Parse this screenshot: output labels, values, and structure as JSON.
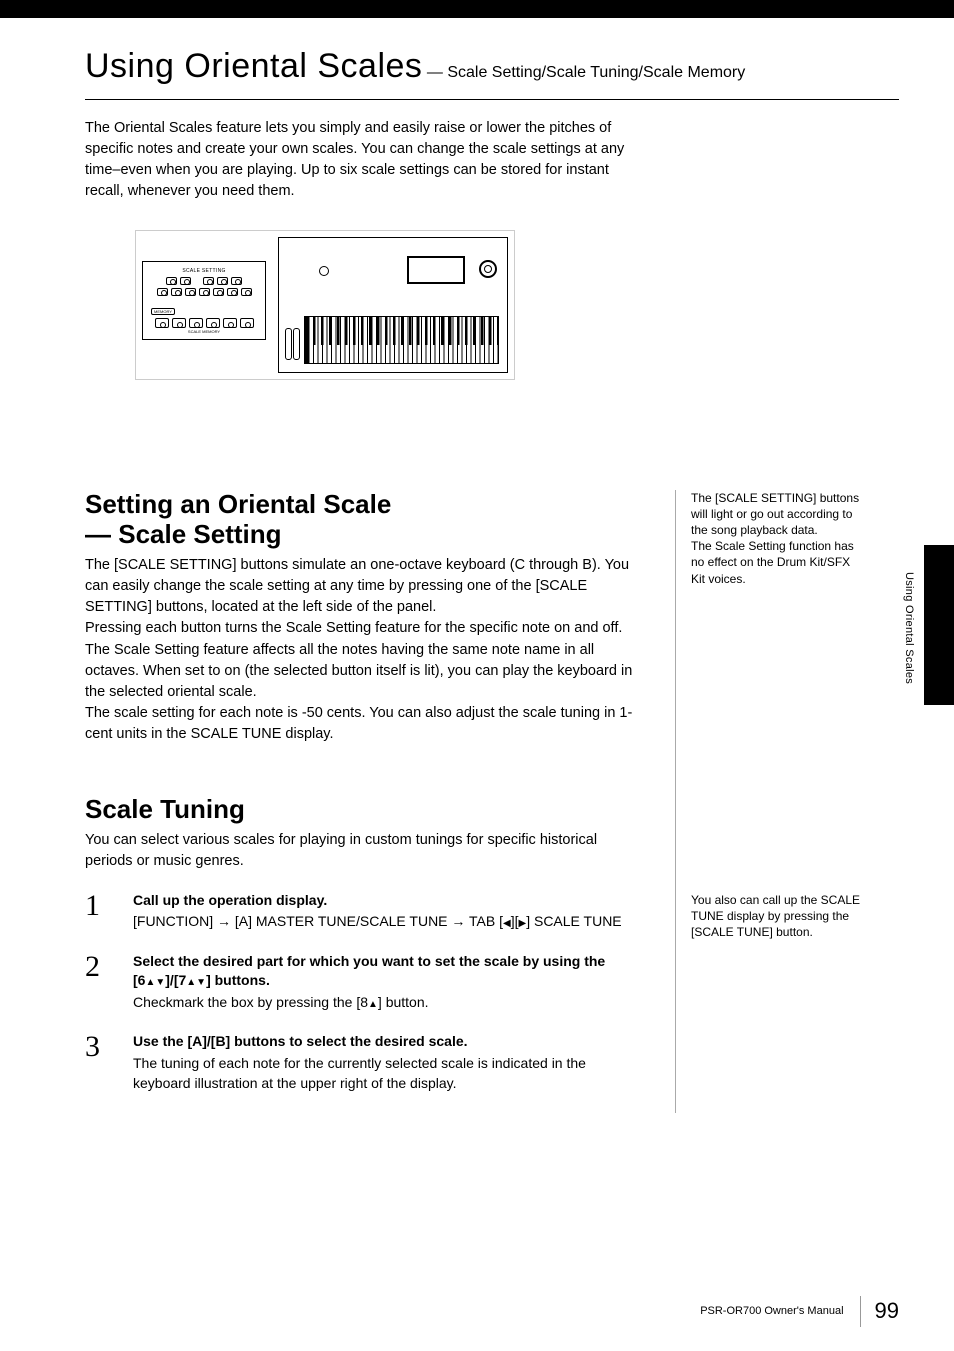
{
  "chapter": {
    "title_main": "Using Oriental Scales",
    "title_sep": " — ",
    "title_sub": "Scale Setting/Scale Tuning/Scale Memory"
  },
  "intro_text": "The Oriental Scales feature lets you simply and easily raise or lower the pitches of specific notes and create your own scales. You can change the scale settings at any time–even when you are playing. Up to six scale settings can be stored for instant recall, whenever you need them.",
  "figure": {
    "scale_setting_label": "SCALE SETTING",
    "memory_label": "MEMORY",
    "scale_memory_label": "SCALE MEMORY"
  },
  "section1": {
    "heading_line1": "Setting an Oriental Scale",
    "heading_line2": "— Scale Setting",
    "p1": "The [SCALE SETTING] buttons simulate an one-octave keyboard (C through B). You can easily change the scale setting at any time by pressing one of the [SCALE SETTING] buttons, located at the left side of the panel.",
    "p2": "Pressing each button turns the Scale Setting feature for the specific note on and off. The Scale Setting feature affects all the notes having the same note name in all octaves. When set to on (the selected button itself is lit), you can play the keyboard in the selected oriental scale.",
    "p3": "The scale setting for each note is -50 cents. You can also adjust the scale tuning in 1-cent units in the SCALE TUNE display."
  },
  "side1": "The [SCALE SETTING] buttons will light or go out according to the song playback data.\nThe Scale Setting function has no effect on the Drum Kit/SFX Kit voices.",
  "section2": {
    "heading": "Scale Tuning",
    "intro": "You can select various scales for playing in custom tunings for specific historical periods or music genres.",
    "steps": [
      {
        "num": "1",
        "title": "Call up the operation display.",
        "text_prefix": "[FUNCTION] → [A] MASTER TUNE/SCALE TUNE → TAB [",
        "text_mid": "][",
        "text_suffix": "] SCALE TUNE"
      },
      {
        "num": "2",
        "title_prefix": "Select the desired part for which you want to set the scale by using the [6",
        "title_mid1": "]/[7",
        "title_suffix": "] buttons.",
        "text_prefix": "Checkmark the box by pressing the [8",
        "text_suffix": "] button."
      },
      {
        "num": "3",
        "title": "Use the [A]/[B] buttons to select the desired scale.",
        "text": "The tuning of each note for the currently selected scale is indicated in the keyboard illustration at the upper right of the display."
      }
    ]
  },
  "side2": "You also can call up the SCALE TUNE display by pressing the [SCALE TUNE] button.",
  "tab_text": "Using Oriental Scales",
  "footer": {
    "manual": "PSR-OR700 Owner's Manual",
    "page": "99"
  }
}
